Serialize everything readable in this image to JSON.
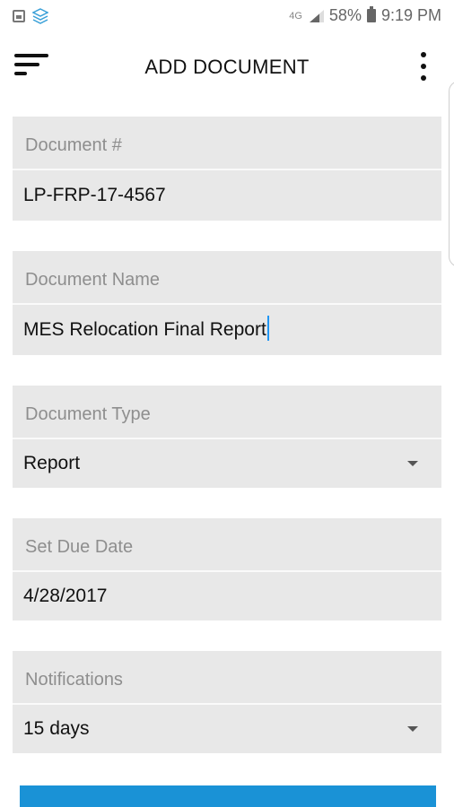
{
  "status_bar": {
    "network": "4G",
    "battery": "58%",
    "time": "9:19 PM"
  },
  "app_bar": {
    "title": "ADD DOCUMENT"
  },
  "form": {
    "document_number": {
      "label": "Document #",
      "value": "LP-FRP-17-4567"
    },
    "document_name": {
      "label": "Document Name",
      "value": "MES Relocation Final Report"
    },
    "document_type": {
      "label": "Document Type",
      "value": "Report"
    },
    "due_date": {
      "label": "Set Due Date",
      "value": "4/28/2017"
    },
    "notifications": {
      "label": "Notifications",
      "value": "15 days"
    }
  },
  "colors": {
    "accent": "#1a92d6",
    "field_bg": "#e8e8e8",
    "caret": "#2196f3"
  }
}
